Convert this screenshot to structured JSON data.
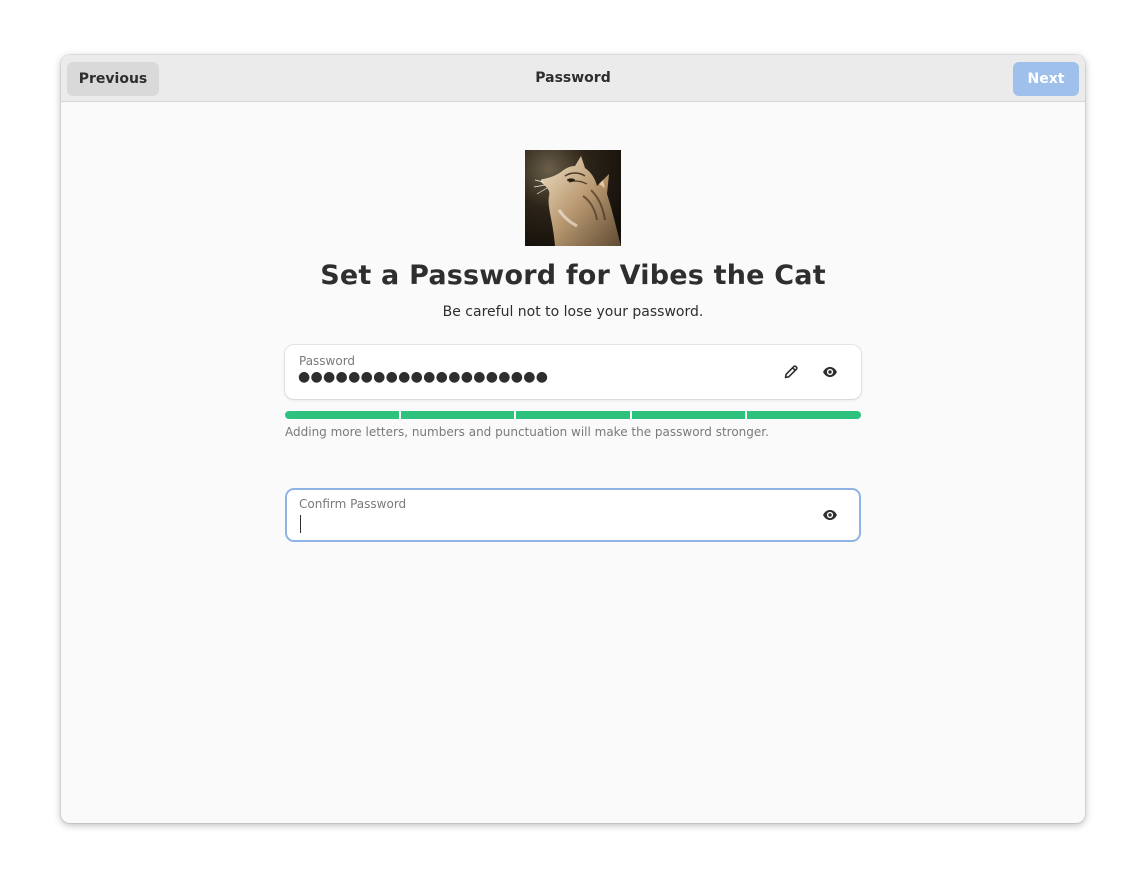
{
  "header": {
    "title": "Password",
    "previous_label": "Previous",
    "next_label": "Next"
  },
  "main": {
    "avatar_alt": "Vibes the Cat avatar",
    "heading": "Set a Password for Vibes the Cat",
    "subheading": "Be careful not to lose your password."
  },
  "password": {
    "label": "Password",
    "masked_value": "●●●●●●●●●●●●●●●●●●●●",
    "edit_icon": "pencil-icon",
    "reveal_icon": "eye-icon"
  },
  "strength": {
    "level": 5,
    "max": 5,
    "color": "#2ec27e",
    "hint": "Adding more letters, numbers and punctuation will make the password stronger."
  },
  "confirm": {
    "label": "Confirm Password",
    "value": "",
    "reveal_icon": "eye-icon"
  },
  "colors": {
    "accent_disabled": "#9fc0ea",
    "focus_ring": "#8eb3e4"
  }
}
